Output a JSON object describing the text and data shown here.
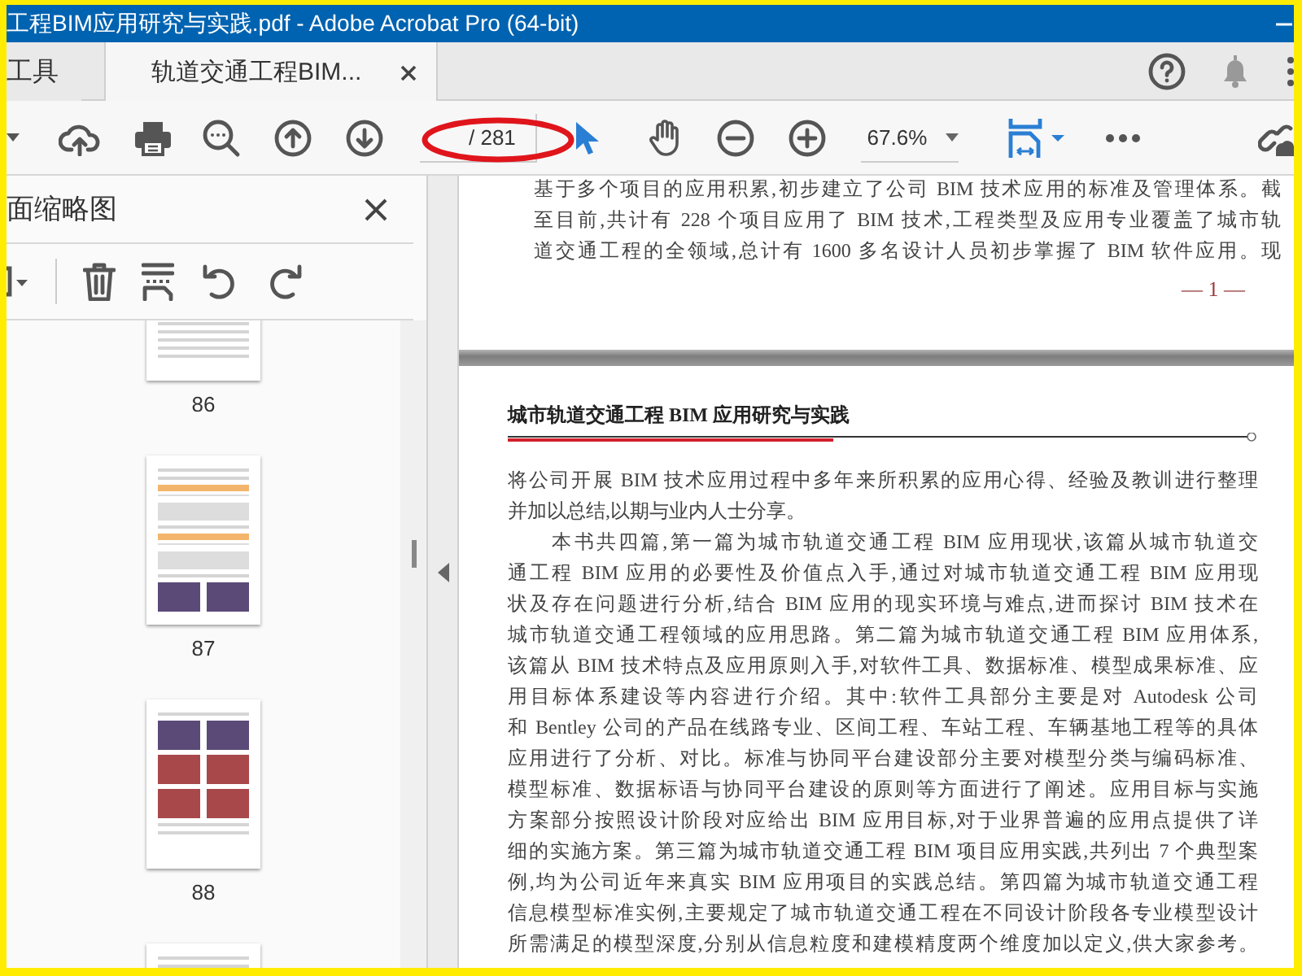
{
  "window": {
    "title": "工程BIM应用研究与实践.pdf - Adobe Acrobat Pro (64-bit)"
  },
  "tabs": [
    {
      "label": "工具",
      "selected": false,
      "closable": false
    },
    {
      "label": "轨道交通工程BIM...",
      "selected": true,
      "closable": true
    }
  ],
  "toolbar": {
    "page_total": "/ 281",
    "zoom": "67.6%"
  },
  "sidebar": {
    "title": "面缩略图",
    "thumbnails": [
      {
        "label": "86",
        "kind": "text"
      },
      {
        "label": "87",
        "kind": "table"
      },
      {
        "label": "88",
        "kind": "figures"
      },
      {
        "kind": "text"
      }
    ]
  },
  "document": {
    "pages": [
      {
        "kind": "body",
        "lines": [
          {
            "text": "基于多个项目的应用积累,初步建立了公司 BIM 技术应用的标准及管理体系。截",
            "kind": "full"
          },
          {
            "text": "至目前,共计有 228 个项目应用了 BIM 技术,工程类型及应用专业覆盖了城市轨",
            "kind": "full"
          },
          {
            "text": "道交通工程的全领域,总计有 1600 多名设计人员初步掌握了 BIM 软件应用。现",
            "kind": "full"
          }
        ],
        "footer": "— 1 —"
      },
      {
        "kind": "body",
        "header": "城市轨道交通工程 BIM 应用研究与实践",
        "lines": [
          {
            "text": "将公司开展 BIM 技术应用过程中多年来所积累的应用心得、经验及教训进行整理",
            "kind": "full"
          },
          {
            "text": "并加以总结,以期与业内人士分享。",
            "kind": "end"
          },
          {
            "text": "　　本书共四篇,第一篇为城市轨道交通工程 BIM 应用现状,该篇从城市轨道交",
            "kind": "full"
          },
          {
            "text": "通工程 BIM 应用的必要性及价值点入手,通过对城市轨道交通工程 BIM 应用现",
            "kind": "full"
          },
          {
            "text": "状及存在问题进行分析,结合 BIM 应用的现实环境与难点,进而探讨 BIM 技术在",
            "kind": "full"
          },
          {
            "text": "城市轨道交通工程领域的应用思路。第二篇为城市轨道交通工程 BIM 应用体系,",
            "kind": "full"
          },
          {
            "text": "该篇从 BIM 技术特点及应用原则入手,对软件工具、数据标准、模型成果标准、应",
            "kind": "full"
          },
          {
            "text": "用目标体系建设等内容进行介绍。其中:软件工具部分主要是对 Autodesk 公司",
            "kind": "full"
          },
          {
            "text": "和 Bentley 公司的产品在线路专业、区间工程、车站工程、车辆基地工程等的具体",
            "kind": "full"
          },
          {
            "text": "应用进行了分析、对比。标准与协同平台建设部分主要对模型分类与编码标准、",
            "kind": "full"
          },
          {
            "text": "模型标准、数据标语与协同平台建设的原则等方面进行了阐述。应用目标与实施",
            "kind": "full"
          },
          {
            "text": "方案部分按照设计阶段对应给出 BIM 应用目标,对于业界普遍的应用点提供了详",
            "kind": "full"
          },
          {
            "text": "细的实施方案。第三篇为城市轨道交通工程 BIM 项目应用实践,共列出 7 个典型案",
            "kind": "full"
          },
          {
            "text": "例,均为公司近年来真实 BIM 应用项目的实践总结。第四篇为城市轨道交通工程",
            "kind": "full"
          },
          {
            "text": "信息模型标准实例,主要规定了城市轨道交通工程在不同设计阶段各专业模型设计",
            "kind": "full"
          },
          {
            "text": "所需满足的模型深度,分别从信息粒度和建模精度两个维度加以定义,供大家参考。",
            "kind": "full"
          }
        ]
      }
    ]
  }
}
